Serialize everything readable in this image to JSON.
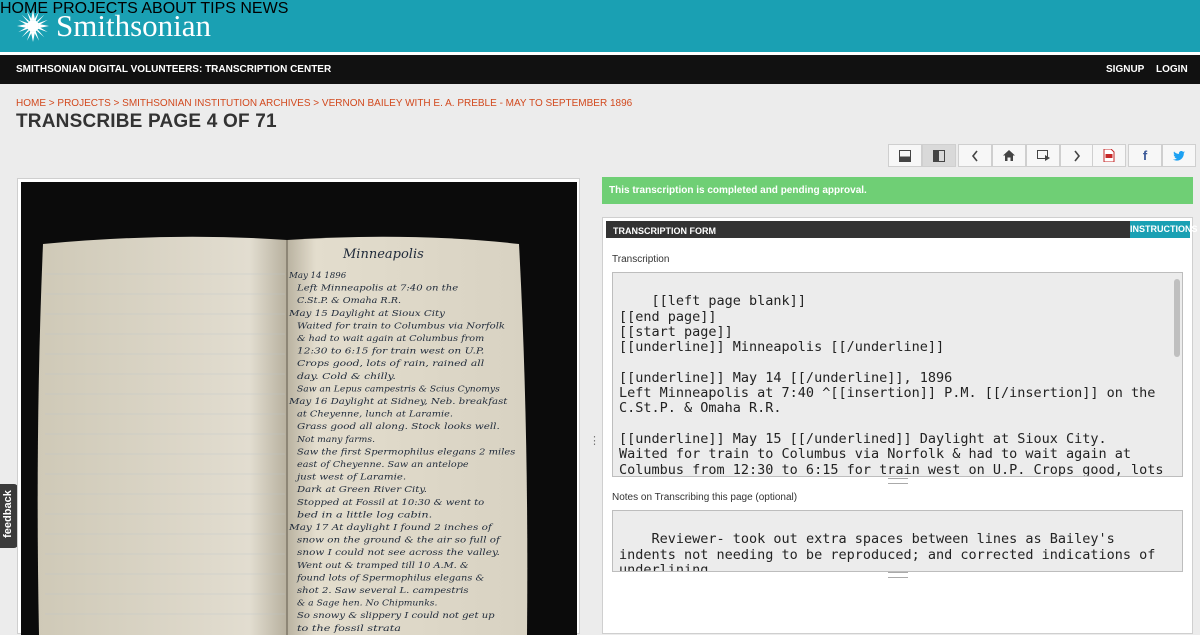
{
  "brand": {
    "name": "Smithsonian"
  },
  "top_nav": [
    "HOME",
    "PROJECTS",
    "ABOUT",
    "TIPS",
    "NEWS"
  ],
  "subheader": {
    "title": "SMITHSONIAN DIGITAL VOLUNTEERS: TRANSCRIPTION CENTER",
    "signup": "SIGNUP",
    "login": "LOGIN"
  },
  "breadcrumb": [
    "HOME",
    "PROJECTS",
    "SMITHSONIAN INSTITUTION ARCHIVES",
    "VERNON BAILEY WITH E. A. PREBLE - MAY TO SEPTEMBER 1896"
  ],
  "breadcrumb_sep": " > ",
  "page_title": "TRANSCRIBE PAGE 4 OF 71",
  "status_message": "This transcription is completed and pending approval.",
  "form": {
    "header": "TRANSCRIPTION FORM",
    "instructions": "INSTRUCTIONS",
    "transcription_label": "Transcription",
    "transcription_text": "[[left page blank]]\n[[end page]]\n[[start page]]\n[[underline]] Minneapolis [[/underline]]\n\n[[underline]] May 14 [[/underline]], 1896\nLeft Minneapolis at 7:40 ^[[insertion]] P.M. [[/insertion]] on the\nC.St.P. & Omaha R.R.\n\n[[underline]] May 15 [[/underlined]] Daylight at Sioux City.\nWaited for train to Columbus via Norfolk & had to wait again at\nColumbus from 12:30 to 6:15 for train west on U.P. Crops good, lots\nof rain, rained all day. Cold & chilly",
    "notes_label": "Notes on Transcribing this page (optional)",
    "notes_text": "Reviewer- took out extra spaces between lines as Bailey's indents not needing to be reproduced; and corrected indications of underlining."
  },
  "feedback_label": "feedback",
  "notebook": {
    "heading": "Minneapolis",
    "lines": [
      "May 14 1896",
      "Left Minneapolis at 7:40 on the",
      "C.St.P. & Omaha R.R.",
      "May 15  Daylight at Sioux City",
      "Waited for train to Columbus via Norfolk",
      "& had to wait again at Columbus from",
      "12:30 to 6:15 for train west on U.P.",
      "Crops good, lots of rain, rained all",
      "day. Cold & chilly.",
      "Saw an Lepus campestris & Scius Cynomys",
      "May 16  Daylight at Sidney, Neb. breakfast",
      "at Cheyenne, lunch at Laramie.",
      "Grass good all along. Stock looks well.",
      "Not many farms.",
      "Saw the first Spermophilus elegans 2 miles",
      "east of Cheyenne. Saw an antelope",
      "just west of Laramie.",
      "Dark at Green River City.",
      "Stopped at Fossil at 10:30 & went to",
      "bed in a little log cabin.",
      "May 17  At daylight I found 2 inches of",
      "snow on the ground & the air so full of",
      "snow I could not see across the valley.",
      "Went out & tramped till 10 A.M. &",
      "found lots of Spermophilus elegans &",
      "shot 2. Saw several L. campestris",
      "& a Sage hen. No Chipmunks.",
      "So snowy & slippery I could not get up",
      "to the fossil strata"
    ]
  },
  "colors": {
    "teal": "#1aa0b3",
    "breadcrumb": "#d2491e",
    "status_green": "#6fcf75",
    "dark": "#111111"
  },
  "toolbar_icons": [
    "layout-horizontal-icon",
    "layout-vertical-icon",
    "prev-page-icon",
    "home-icon",
    "switch-page-icon",
    "next-page-icon",
    "pdf-icon",
    "facebook-icon",
    "twitter-icon"
  ]
}
